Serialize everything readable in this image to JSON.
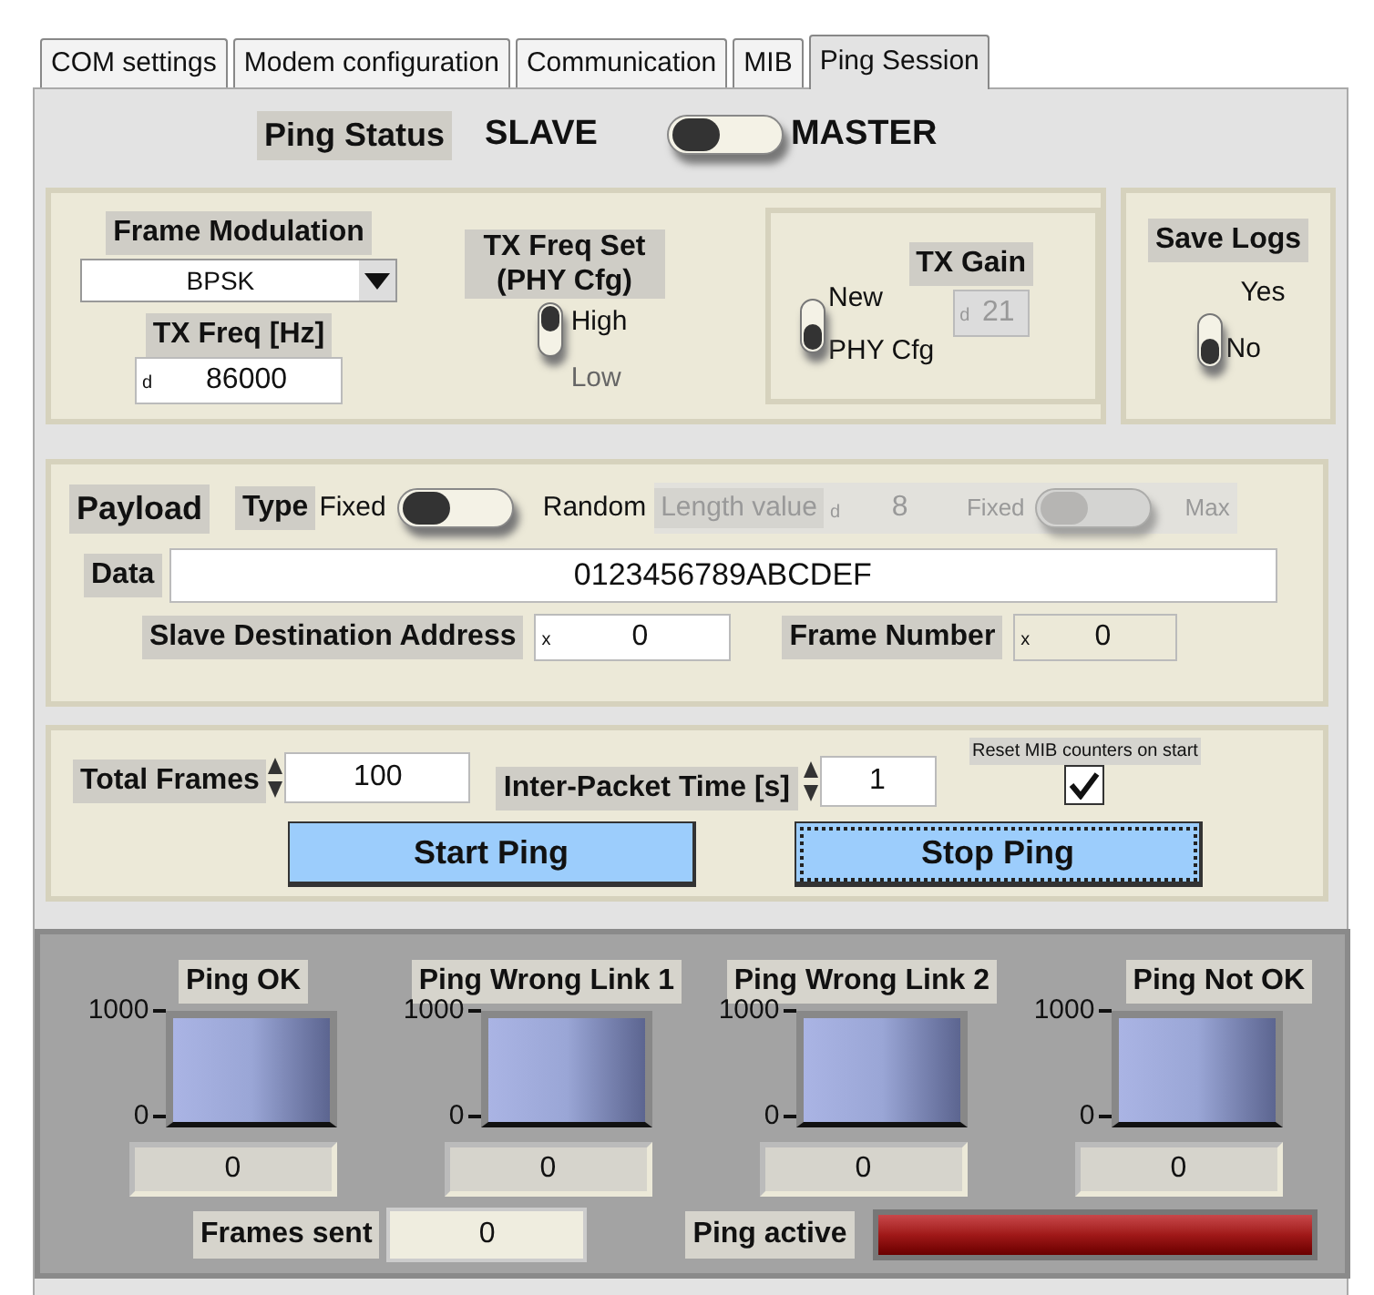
{
  "tabs": [
    {
      "label": "COM settings",
      "selected": false
    },
    {
      "label": "Modem configuration",
      "selected": false
    },
    {
      "label": "Communication",
      "selected": false
    },
    {
      "label": "MIB",
      "selected": false
    },
    {
      "label": "Ping Session",
      "selected": true
    }
  ],
  "ping_status": {
    "label": "Ping Status",
    "off_label": "SLAVE",
    "on_label": "MASTER",
    "on": false
  },
  "frame_modulation": {
    "label": "Frame Modulation",
    "value": "BPSK"
  },
  "tx_freq": {
    "label": "TX Freq [Hz]",
    "radix": "d",
    "value": "86000"
  },
  "tx_freq_set": {
    "label": "TX Freq Set (PHY Cfg)",
    "on_label": "High",
    "off_label": "Low",
    "on": true
  },
  "tx_gain": {
    "label": "TX Gain",
    "on_label": "New",
    "off_label": "PHY Cfg",
    "on": false,
    "radix": "d",
    "value": "21",
    "disabled": true
  },
  "save_logs": {
    "label": "Save Logs",
    "on_label": "Yes",
    "off_label": "No",
    "on": false
  },
  "payload": {
    "label": "Payload",
    "type_label": "Type",
    "off_label": "Fixed",
    "on_label": "Random",
    "on": false,
    "length": {
      "label": "Length value",
      "radix": "d",
      "value": "8",
      "off_label": "Fixed",
      "on_label": "Max",
      "on": false,
      "disabled": true
    },
    "data_label": "Data",
    "data": "0123456789ABCDEF",
    "slave_address": {
      "label": "Slave Destination Address",
      "radix": "x",
      "value": "0"
    },
    "frame_number": {
      "label": "Frame Number",
      "radix": "x",
      "value": "0"
    }
  },
  "session": {
    "total_frames": {
      "label": "Total Frames",
      "value": "100"
    },
    "inter_packet": {
      "label": "Inter-Packet Time [s]",
      "value": "1"
    },
    "reset": {
      "label": "Reset MIB counters on start",
      "checked": true
    },
    "buttons": [
      {
        "label": "Start Ping",
        "focused": false
      },
      {
        "label": "Stop Ping",
        "focused": true
      }
    ]
  },
  "meters": [
    {
      "label": "Ping OK",
      "scale_max": "1000",
      "scale_min": "0",
      "value": "0"
    },
    {
      "label": "Ping Wrong Link 1",
      "scale_max": "1000",
      "scale_min": "0",
      "value": "0"
    },
    {
      "label": "Ping Wrong Link 2",
      "scale_max": "1000",
      "scale_min": "0",
      "value": "0"
    },
    {
      "label": "Ping Not OK",
      "scale_max": "1000",
      "scale_min": "0",
      "value": "0"
    }
  ],
  "frames_sent": {
    "label": "Frames sent",
    "value": "0"
  },
  "ping_active": {
    "label": "Ping active",
    "on": true
  }
}
